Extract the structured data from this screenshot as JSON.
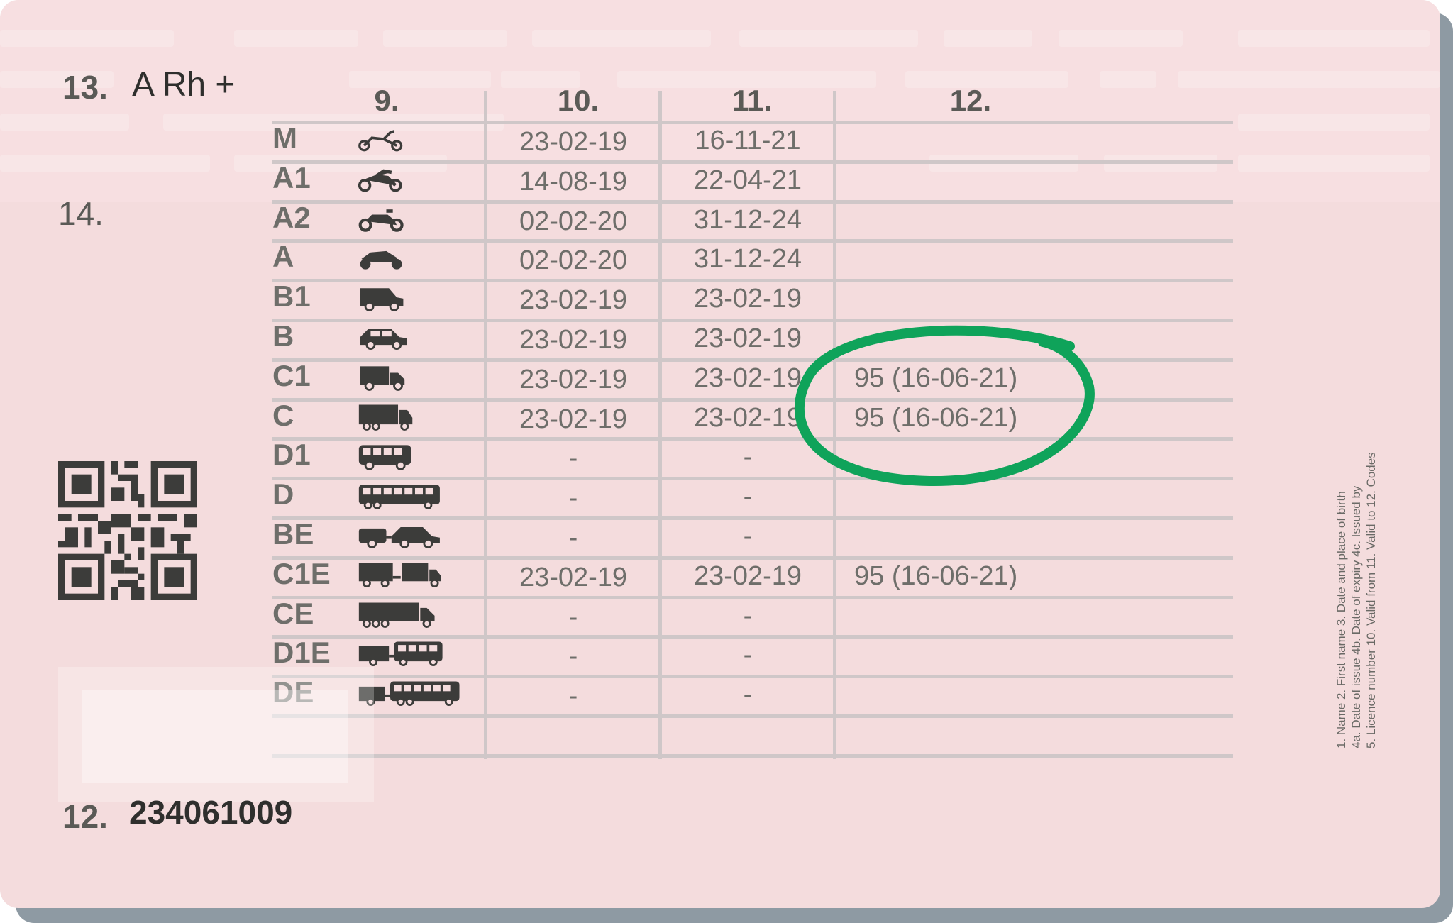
{
  "field13": {
    "label": "13.",
    "value": "A Rh +"
  },
  "field14": {
    "label": "14."
  },
  "field12": {
    "label": "12.",
    "value": "234061009"
  },
  "headers": [
    "9.",
    "10.",
    "11.",
    "12."
  ],
  "rows": [
    {
      "category": "M",
      "icon": "moped-icon",
      "from": "23-02-19",
      "to": "16-11-21",
      "code": ""
    },
    {
      "category": "A1",
      "icon": "light-motorcycle-icon",
      "from": "14-08-19",
      "to": "22-04-21",
      "code": ""
    },
    {
      "category": "A2",
      "icon": "motorcycle-icon",
      "from": "02-02-20",
      "to": "31-12-24",
      "code": ""
    },
    {
      "category": "A",
      "icon": "sport-motorcycle-icon",
      "from": "02-02-20",
      "to": "31-12-24",
      "code": ""
    },
    {
      "category": "B1",
      "icon": "van-icon",
      "from": "23-02-19",
      "to": "23-02-19",
      "code": ""
    },
    {
      "category": "B",
      "icon": "car-icon",
      "from": "23-02-19",
      "to": "23-02-19",
      "code": ""
    },
    {
      "category": "C1",
      "icon": "small-truck-icon",
      "from": "23-02-19",
      "to": "23-02-19",
      "code": "95 (16-06-21)"
    },
    {
      "category": "C",
      "icon": "truck-icon",
      "from": "23-02-19",
      "to": "23-02-19",
      "code": "95 (16-06-21)"
    },
    {
      "category": "D1",
      "icon": "minibus-icon",
      "from": "-",
      "to": "-",
      "code": ""
    },
    {
      "category": "D",
      "icon": "bus-icon",
      "from": "-",
      "to": "-",
      "code": ""
    },
    {
      "category": "BE",
      "icon": "car-with-trailer-icon",
      "from": "-",
      "to": "-",
      "code": ""
    },
    {
      "category": "C1E",
      "icon": "truck-with-trailer-icon",
      "from": "23-02-19",
      "to": "23-02-19",
      "code": "95 (16-06-21)"
    },
    {
      "category": "CE",
      "icon": "articulated-truck-icon",
      "from": "-",
      "to": "-",
      "code": ""
    },
    {
      "category": "D1E",
      "icon": "minibus-with-trailer-icon",
      "from": "-",
      "to": "-",
      "code": ""
    },
    {
      "category": "DE",
      "icon": "bus-with-trailer-icon",
      "from": "-",
      "to": "-",
      "code": ""
    }
  ],
  "legend": [
    "1. Name  2. First name  3. Date and place of birth",
    "4a. Date of issue  4b. Date of expiry  4c. Issued by",
    "5. Licence number  10. Valid from  11. Valid to  12. Codes"
  ],
  "colors": {
    "card": "#f4dcdd",
    "text": "#6e6e6a",
    "annotation": "#0fa35a"
  }
}
